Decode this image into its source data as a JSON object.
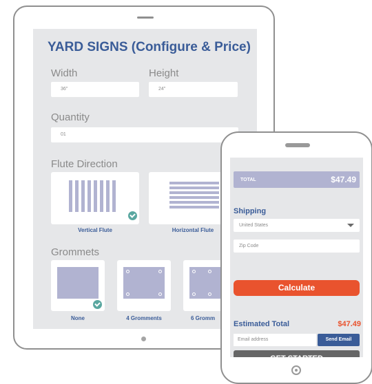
{
  "tablet": {
    "title": "YARD SIGNS (Configure & Price)",
    "width_label": "Width",
    "width_value": "36\"",
    "height_label": "Height",
    "height_value": "24\"",
    "quantity_label": "Quantity",
    "quantity_value": "01",
    "flute_label": "Flute Direction",
    "flute_options": [
      {
        "label": "Vertical Flute",
        "selected": true
      },
      {
        "label": "Horizontal Flute",
        "selected": false
      }
    ],
    "grommets_label": "Grommets",
    "grommet_options": [
      {
        "label": "None",
        "selected": true
      },
      {
        "label": "4 Gromments",
        "selected": false
      },
      {
        "label": "6 Gromm",
        "selected": false
      }
    ]
  },
  "phone": {
    "total_label": "TOTAL",
    "total_value": "$47.49",
    "shipping_heading": "Shipping",
    "country_value": "United States",
    "zip_placeholder": "Zip Code",
    "calculate_label": "Calculate",
    "estimated_label": "Estimated Total",
    "estimated_value": "$47.49",
    "email_placeholder": "Email address",
    "send_email_label": "Send Email",
    "get_started_label": "GET STARTED"
  },
  "colors": {
    "brand_blue": "#3a5c98",
    "accent_orange": "#e9532e",
    "swatch_lavender": "#b1b3d1",
    "check_teal": "#5aa7a0",
    "screen_gray": "#e6e7e9"
  },
  "icons": [
    "check-icon",
    "chevron-down-icon",
    "grommet-hole-icon"
  ]
}
